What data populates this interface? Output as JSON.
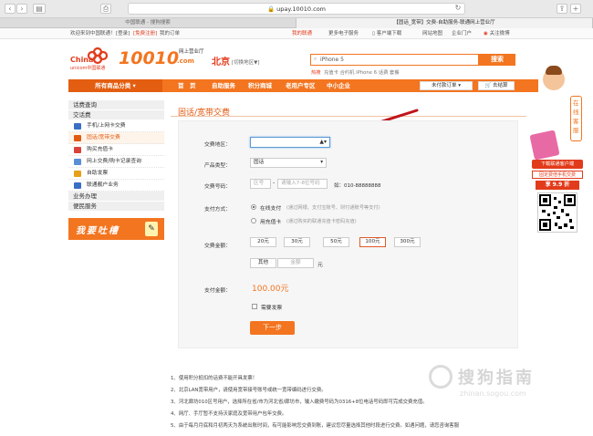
{
  "browser": {
    "url": "upay.10010.com",
    "tabs": [
      {
        "label": "中国联通 - 搜狗搜索"
      },
      {
        "label": "【固话_宽带】交费-自助服务-联通网上营业厅"
      }
    ]
  },
  "topbar": {
    "welcome": "欢迎来到中国联通！",
    "login": "[登录]",
    "register": "[免费注册]",
    "my_orders": "我的订单",
    "links": [
      "我的联通",
      "更多电子服务",
      "客户端下载",
      "网站地图",
      "企业门户",
      "关注微博"
    ]
  },
  "header": {
    "brand_cn": "China",
    "brand_sub": "unicom中国联通",
    "logo_num": "10010",
    "logo_dotcom": ".com",
    "logo_tag": "网上营业厅",
    "city": "北京",
    "city_switch": "[切换地区▼]",
    "search_value": "iPhone 5",
    "search_button": "搜索",
    "hot_label": "热搜",
    "hot_terms": "充值卡  合约机  iPhone 6  话费  套餐"
  },
  "mainnav": {
    "all_categories": "所有商品分类",
    "items": [
      "首　页",
      "自助服务",
      "积分商城",
      "老用户专区",
      "中小企业"
    ],
    "orders": "未付款订单",
    "cart": "去结算"
  },
  "sidebar": {
    "sections": [
      {
        "title": "话费查询",
        "items": []
      },
      {
        "title": "交话费",
        "items": [
          "手机/上网卡交费",
          "固话/宽带交费",
          "购买充值卡",
          "网上交费/购卡记录查询",
          "自助发票",
          "联通靓户业务"
        ]
      },
      {
        "title": "业务办理",
        "items": []
      },
      {
        "title": "便民服务",
        "items": []
      }
    ],
    "complaint_banner": "我要吐槽"
  },
  "page": {
    "title": "固话/宽带交费"
  },
  "form": {
    "region_label": "交费地区：",
    "product_label": "产品类型：",
    "product_value": "固话",
    "number_label": "交费号码：",
    "area_code_placeholder": "区号",
    "number_placeholder": "请输入7-8位号码",
    "number_example": "如：010-88888888",
    "payment_label": "支付方式：",
    "pay_online": "在线支付",
    "pay_online_hint": "(通过网银、支付宝账号、财付通账号等支付)",
    "pay_card": "用充值卡",
    "pay_card_hint": "(通过购买的联通充值卡密码充值)",
    "amount_label": "交费金额：",
    "amounts": [
      "20元",
      "30元",
      "50元",
      "100元",
      "300元"
    ],
    "selected_amount_index": 3,
    "other_label": "其他",
    "amount_placeholder": "金额",
    "yuan": "元",
    "total_label": "支付金额：",
    "total_value": "100.00元",
    "invoice_label": "需要发票",
    "next_button": "下一步"
  },
  "notes": [
    "1、使用积分抵扣的话费不能开具发票！",
    "2、北京LAN宽带用户，请使用宽带接号账号或统一宽带编码进行交费。",
    "3、河北廊坊010区号用户，选择所在省/市为河北省/廊坊市，输入缴费号码为0316+8位电话号码即可完成交费充值。",
    "4、网厅、手厅暂不支持沃家庭及宽带用户包年交费。",
    "5、由于每月月底和月初两天为系统出账时间，有可能影响您交费到账，建议您尽量选择其他时段进行交费。如遇问题，请您咨询客服"
  ],
  "right_banner": {
    "online_service": [
      "在",
      "线",
      "客",
      "服"
    ],
    "download": "下载联通客户端",
    "recharge": "固定费倍手机交费",
    "discount": "享 9.9 折"
  },
  "watermark": {
    "text": "搜狗指南",
    "url": "zhinan.sogou.com"
  },
  "colors": {
    "brand_orange": "#f37520",
    "accent_red": "#e23b1b",
    "price_orange": "#f37520"
  }
}
